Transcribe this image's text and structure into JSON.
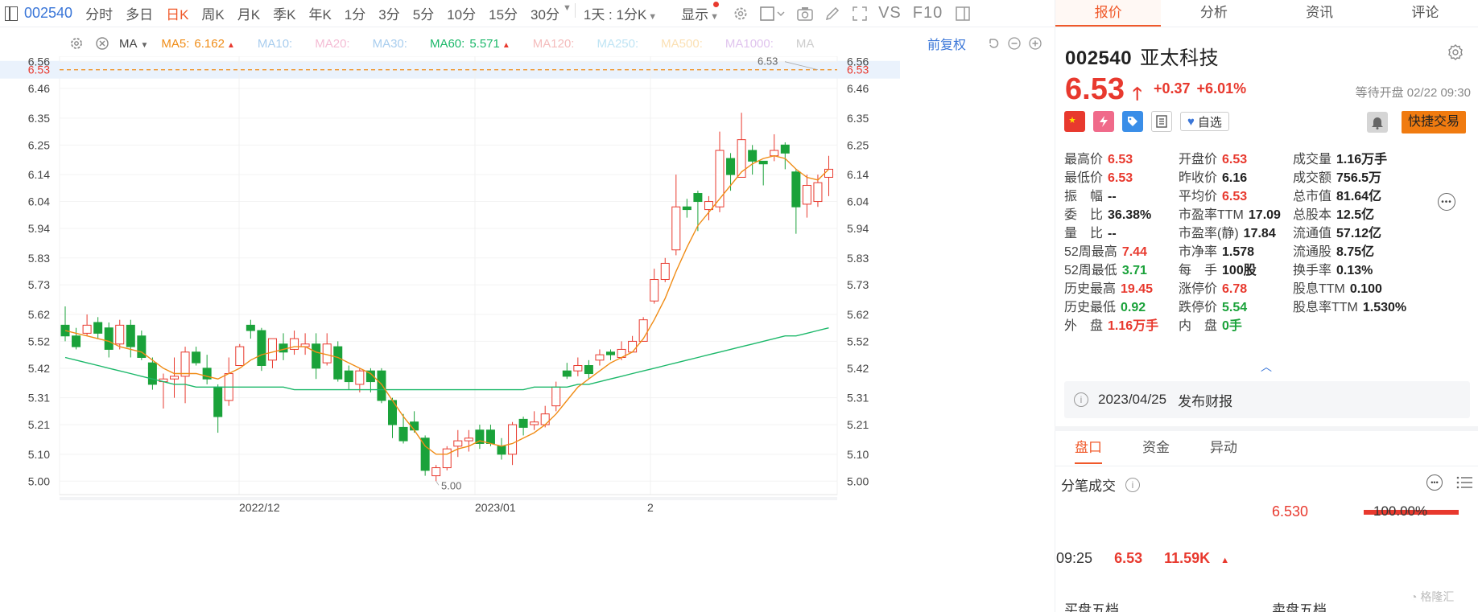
{
  "toolbar": {
    "code": "002540",
    "periods": [
      "分时",
      "多日",
      "日K",
      "周K",
      "月K",
      "季K",
      "年K",
      "1分",
      "3分",
      "5分",
      "10分",
      "15分",
      "30分"
    ],
    "active_period": "日K",
    "range_select": "1天 : 1分K",
    "display": "显示",
    "text_icons": [
      "VS",
      "F10"
    ]
  },
  "ma_bar": {
    "label": "MA",
    "items": [
      {
        "label": "MA5:",
        "value": "6.162",
        "color": "#f08c16",
        "up": true
      },
      {
        "label": "MA10:",
        "value": "",
        "color": "#a8cdee"
      },
      {
        "label": "MA20:",
        "value": "",
        "color": "#f4bcd4"
      },
      {
        "label": "MA30:",
        "value": "",
        "color": "#a8cdee"
      },
      {
        "label": "MA60:",
        "value": "5.571",
        "color": "#1cb86a",
        "up": true
      },
      {
        "label": "MA120:",
        "value": "",
        "color": "#f4bcbc"
      },
      {
        "label": "MA250:",
        "value": "",
        "color": "#bfe4f4"
      },
      {
        "label": "MA500:",
        "value": "",
        "color": "#fbe0b4"
      },
      {
        "label": "MA1000:",
        "value": "",
        "color": "#e0c4ee"
      },
      {
        "label": "MA",
        "value": "",
        "color": "#cccccc"
      }
    ],
    "fq": "前复权"
  },
  "chart_data": {
    "type": "candlestick",
    "current_price_line": 6.53,
    "y_ticks": [
      "6.56",
      "6.53",
      "6.46",
      "6.35",
      "6.25",
      "6.14",
      "6.04",
      "5.94",
      "5.83",
      "5.73",
      "5.62",
      "5.52",
      "5.42",
      "5.31",
      "5.21",
      "5.10",
      "5.00"
    ],
    "x_labels": [
      "2022/12",
      "2023/01",
      "2"
    ],
    "max_label": "6.53",
    "min_label": "5.00",
    "candles": [
      [
        5.58,
        5.54,
        5.65,
        5.52
      ],
      [
        5.54,
        5.5,
        5.57,
        5.49
      ],
      [
        5.55,
        5.58,
        5.62,
        5.54
      ],
      [
        5.59,
        5.55,
        5.61,
        5.53
      ],
      [
        5.57,
        5.49,
        5.59,
        5.46
      ],
      [
        5.51,
        5.58,
        5.6,
        5.49
      ],
      [
        5.58,
        5.5,
        5.6,
        5.46
      ],
      [
        5.54,
        5.46,
        5.56,
        5.45
      ],
      [
        5.44,
        5.36,
        5.46,
        5.34
      ],
      [
        5.37,
        5.38,
        5.4,
        5.27
      ],
      [
        5.38,
        5.39,
        5.46,
        5.31
      ],
      [
        5.39,
        5.48,
        5.5,
        5.29
      ],
      [
        5.48,
        5.44,
        5.5,
        5.43
      ],
      [
        5.42,
        5.38,
        5.47,
        5.36
      ],
      [
        5.35,
        5.24,
        5.36,
        5.18
      ],
      [
        5.3,
        5.4,
        5.46,
        5.28
      ],
      [
        5.43,
        5.5,
        5.51,
        5.43
      ],
      [
        5.58,
        5.56,
        5.6,
        5.53
      ],
      [
        5.56,
        5.43,
        5.57,
        5.41
      ],
      [
        5.45,
        5.53,
        5.53,
        5.42
      ],
      [
        5.51,
        5.48,
        5.55,
        5.45
      ],
      [
        5.49,
        5.53,
        5.56,
        5.47
      ],
      [
        5.5,
        5.51,
        5.55,
        5.47
      ],
      [
        5.51,
        5.42,
        5.55,
        5.38
      ],
      [
        5.44,
        5.51,
        5.55,
        5.43
      ],
      [
        5.5,
        5.38,
        5.52,
        5.37
      ],
      [
        5.41,
        5.37,
        5.43,
        5.34
      ],
      [
        5.36,
        5.41,
        5.42,
        5.33
      ],
      [
        5.41,
        5.37,
        5.42,
        5.33
      ],
      [
        5.41,
        5.3,
        5.42,
        5.29
      ],
      [
        5.3,
        5.21,
        5.31,
        5.16
      ],
      [
        5.2,
        5.15,
        5.25,
        5.14
      ],
      [
        5.22,
        5.19,
        5.26,
        5.18
      ],
      [
        5.16,
        5.04,
        5.17,
        5.02
      ],
      [
        5.02,
        5.05,
        5.06,
        5.0
      ],
      [
        5.05,
        5.12,
        5.13,
        5.04
      ],
      [
        5.13,
        5.15,
        5.19,
        5.09
      ],
      [
        5.15,
        5.16,
        5.19,
        5.11
      ],
      [
        5.19,
        5.14,
        5.21,
        5.12
      ],
      [
        5.19,
        5.14,
        5.21,
        5.13
      ],
      [
        5.13,
        5.1,
        5.16,
        5.08
      ],
      [
        5.1,
        5.21,
        5.22,
        5.06
      ],
      [
        5.23,
        5.2,
        5.24,
        5.17
      ],
      [
        5.21,
        5.22,
        5.26,
        5.19
      ],
      [
        5.21,
        5.25,
        5.28,
        5.2
      ],
      [
        5.28,
        5.35,
        5.37,
        5.26
      ],
      [
        5.41,
        5.39,
        5.44,
        5.38
      ],
      [
        5.41,
        5.43,
        5.46,
        5.39
      ],
      [
        5.43,
        5.4,
        5.45,
        5.38
      ],
      [
        5.45,
        5.47,
        5.49,
        5.43
      ],
      [
        5.48,
        5.47,
        5.49,
        5.45
      ],
      [
        5.46,
        5.49,
        5.52,
        5.45
      ],
      [
        5.48,
        5.52,
        5.54,
        5.48
      ],
      [
        5.52,
        5.6,
        5.61,
        5.52
      ],
      [
        5.67,
        5.75,
        5.79,
        5.66
      ],
      [
        5.75,
        5.81,
        5.83,
        5.74
      ],
      [
        5.86,
        6.02,
        6.14,
        5.84
      ],
      [
        6.02,
        6.01,
        6.05,
        5.98
      ],
      [
        6.07,
        6.04,
        6.08,
        5.93
      ],
      [
        6.01,
        6.04,
        6.06,
        5.97
      ],
      [
        6.02,
        6.23,
        6.3,
        6.0
      ],
      [
        6.2,
        6.14,
        6.22,
        6.08
      ],
      [
        6.13,
        6.27,
        6.37,
        6.13
      ],
      [
        6.23,
        6.19,
        6.25,
        6.14
      ],
      [
        6.19,
        6.18,
        6.19,
        6.1
      ],
      [
        6.21,
        6.23,
        6.29,
        6.19
      ],
      [
        6.25,
        6.22,
        6.26,
        6.16
      ],
      [
        6.15,
        6.02,
        6.16,
        5.92
      ],
      [
        6.03,
        6.1,
        6.14,
        5.98
      ],
      [
        6.04,
        6.11,
        6.14,
        6.02
      ],
      [
        6.13,
        6.16,
        6.21,
        6.06
      ]
    ],
    "ma5": [
      5.56,
      5.55,
      5.54,
      5.53,
      5.52,
      5.5,
      5.49,
      5.48,
      5.45,
      5.42,
      5.4,
      5.4,
      5.4,
      5.39,
      5.38,
      5.4,
      5.42,
      5.45,
      5.47,
      5.48,
      5.49,
      5.5,
      5.5,
      5.48,
      5.47,
      5.46,
      5.44,
      5.42,
      5.4,
      5.36,
      5.3,
      5.24,
      5.19,
      5.13,
      5.1,
      5.1,
      5.12,
      5.13,
      5.15,
      5.14,
      5.13,
      5.14,
      5.16,
      5.18,
      5.21,
      5.25,
      5.3,
      5.35,
      5.38,
      5.41,
      5.44,
      5.46,
      5.48,
      5.53,
      5.6,
      5.68,
      5.78,
      5.87,
      5.95,
      6.0,
      6.05,
      6.1,
      6.15,
      6.18,
      6.2,
      6.21,
      6.2,
      6.16,
      6.13,
      6.12,
      6.16
    ],
    "ma60": [
      5.46,
      5.45,
      5.44,
      5.43,
      5.42,
      5.41,
      5.4,
      5.39,
      5.38,
      5.37,
      5.36,
      5.36,
      5.35,
      5.35,
      5.35,
      5.35,
      5.35,
      5.35,
      5.35,
      5.35,
      5.35,
      5.34,
      5.34,
      5.34,
      5.34,
      5.34,
      5.34,
      5.34,
      5.34,
      5.34,
      5.34,
      5.34,
      5.34,
      5.34,
      5.34,
      5.34,
      5.34,
      5.34,
      5.34,
      5.34,
      5.34,
      5.34,
      5.34,
      5.35,
      5.35,
      5.35,
      5.35,
      5.36,
      5.36,
      5.37,
      5.38,
      5.39,
      5.4,
      5.41,
      5.42,
      5.43,
      5.44,
      5.45,
      5.46,
      5.47,
      5.48,
      5.49,
      5.5,
      5.51,
      5.52,
      5.53,
      5.54,
      5.54,
      5.55,
      5.56,
      5.57
    ]
  },
  "tabs": [
    "报价",
    "分析",
    "资讯",
    "评论"
  ],
  "active_tab": "报价",
  "quote": {
    "code": "002540",
    "name": "亚太科技",
    "price": "6.53",
    "change": "+0.37",
    "change_pct": "+6.01%",
    "status": "等待开盘 02/22 09:30",
    "watch": "自选",
    "fast_trade": "快捷交易"
  },
  "stats": [
    [
      {
        "k": "最高价",
        "v": "6.53",
        "c": "red"
      },
      {
        "k": "开盘价",
        "v": "6.53",
        "c": "red"
      },
      {
        "k": "成交量",
        "v": "1.16万手",
        "c": "dark"
      }
    ],
    [
      {
        "k": "最低价",
        "v": "6.53",
        "c": "red"
      },
      {
        "k": "昨收价",
        "v": "6.16",
        "c": "dark"
      },
      {
        "k": "成交额",
        "v": "756.5万",
        "c": "dark"
      }
    ],
    [
      {
        "k": "振　幅",
        "v": "--",
        "c": "dark"
      },
      {
        "k": "平均价",
        "v": "6.53",
        "c": "red"
      },
      {
        "k": "总市值",
        "v": "81.64亿",
        "c": "dark"
      }
    ],
    [
      {
        "k": "委　比",
        "v": "36.38%",
        "c": "dark"
      },
      {
        "k": "市盈率TTM",
        "v": "17.09",
        "c": "dark"
      },
      {
        "k": "总股本",
        "v": "12.5亿",
        "c": "dark"
      }
    ],
    [
      {
        "k": "量　比",
        "v": "--",
        "c": "dark"
      },
      {
        "k": "市盈率(静)",
        "v": "17.84",
        "c": "dark"
      },
      {
        "k": "流通值",
        "v": "57.12亿",
        "c": "dark"
      }
    ],
    [
      {
        "k": "52周最高",
        "v": "7.44",
        "c": "red"
      },
      {
        "k": "市净率",
        "v": "1.578",
        "c": "dark"
      },
      {
        "k": "流通股",
        "v": "8.75亿",
        "c": "dark"
      }
    ],
    [
      {
        "k": "52周最低",
        "v": "3.71",
        "c": "green"
      },
      {
        "k": "每　手",
        "v": "100股",
        "c": "dark"
      },
      {
        "k": "换手率",
        "v": "0.13%",
        "c": "dark"
      }
    ],
    [
      {
        "k": "历史最高",
        "v": "19.45",
        "c": "red"
      },
      {
        "k": "涨停价",
        "v": "6.78",
        "c": "red"
      },
      {
        "k": "股息TTM",
        "v": "0.100",
        "c": "dark"
      }
    ],
    [
      {
        "k": "历史最低",
        "v": "0.92",
        "c": "green"
      },
      {
        "k": "跌停价",
        "v": "5.54",
        "c": "green"
      },
      {
        "k": "股息率TTM",
        "v": "1.530%",
        "c": "dark"
      }
    ],
    [
      {
        "k": "外　盘",
        "v": "1.16万手",
        "c": "red"
      },
      {
        "k": "内　盘",
        "v": "0手",
        "c": "green"
      }
    ]
  ],
  "report": {
    "date": "2023/04/25",
    "text": "发布财报"
  },
  "subtabs": [
    "盘口",
    "资金",
    "异动"
  ],
  "active_subtab": "盘口",
  "ticks": {
    "title": "分笔成交",
    "price": "6.530",
    "pct": "100.00%",
    "row_time": "09:25",
    "row_price": "6.53",
    "row_vol": "11.59K"
  },
  "orderbook": {
    "buy": "买盘五档",
    "sell": "卖盘五档"
  },
  "watermark": "格隆汇"
}
